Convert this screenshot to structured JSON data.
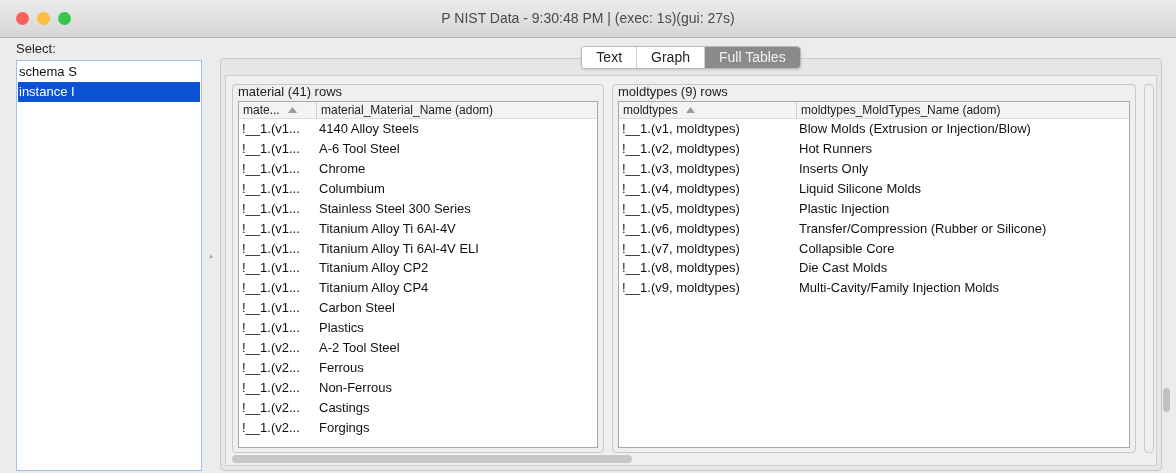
{
  "window": {
    "title": "P NIST Data - 9:30:48 PM | (exec: 1s)(gui: 27s)"
  },
  "select": {
    "label": "Select:",
    "items": [
      {
        "label": "schema S",
        "selected": false
      },
      {
        "label": "instance I",
        "selected": true
      }
    ]
  },
  "tabs": [
    {
      "label": "Text",
      "selected": false
    },
    {
      "label": "Graph",
      "selected": false
    },
    {
      "label": "Full Tables",
      "selected": true
    }
  ],
  "tables": [
    {
      "title": "material (41) rows",
      "columns": [
        "mate...",
        "material_Material_Name (adom)"
      ],
      "rows": [
        [
          "!__1.(v1...",
          "4140 Alloy Steels"
        ],
        [
          "!__1.(v1...",
          "A-6 Tool Steel"
        ],
        [
          "!__1.(v1...",
          "Chrome"
        ],
        [
          "!__1.(v1...",
          "Columbium"
        ],
        [
          "!__1.(v1...",
          "Stainless Steel 300 Series"
        ],
        [
          "!__1.(v1...",
          "Titanium Alloy Ti 6Al-4V"
        ],
        [
          "!__1.(v1...",
          "Titanium Alloy Ti 6Al-4V ELI"
        ],
        [
          "!__1.(v1...",
          "Titanium Alloy CP2"
        ],
        [
          "!__1.(v1...",
          "Titanium Alloy CP4"
        ],
        [
          "!__1.(v1...",
          "Carbon Steel"
        ],
        [
          "!__1.(v1...",
          "Plastics"
        ],
        [
          "!__1.(v2...",
          "A-2 Tool Steel"
        ],
        [
          "!__1.(v2...",
          "Ferrous"
        ],
        [
          "!__1.(v2...",
          "Non-Ferrous"
        ],
        [
          "!__1.(v2...",
          "Castings"
        ],
        [
          "!__1.(v2...",
          "Forgings"
        ]
      ]
    },
    {
      "title": "moldtypes (9) rows",
      "columns": [
        "moldtypes",
        "moldtypes_MoldTypes_Name (adom)"
      ],
      "rows": [
        [
          "!__1.(v1, moldtypes)",
          "Blow Molds (Extrusion or Injection/Blow)"
        ],
        [
          "!__1.(v2, moldtypes)",
          "Hot Runners"
        ],
        [
          "!__1.(v3, moldtypes)",
          "Inserts Only"
        ],
        [
          "!__1.(v4, moldtypes)",
          "Liquid Silicone Molds"
        ],
        [
          "!__1.(v5, moldtypes)",
          "Plastic Injection"
        ],
        [
          "!__1.(v6, moldtypes)",
          "Transfer/Compression (Rubber or Silicone)"
        ],
        [
          "!__1.(v7, moldtypes)",
          "Collapsible Core"
        ],
        [
          "!__1.(v8, moldtypes)",
          "Die Cast Molds"
        ],
        [
          "!__1.(v9, moldtypes)",
          "Multi-Cavity/Family Injection Molds"
        ]
      ]
    }
  ]
}
